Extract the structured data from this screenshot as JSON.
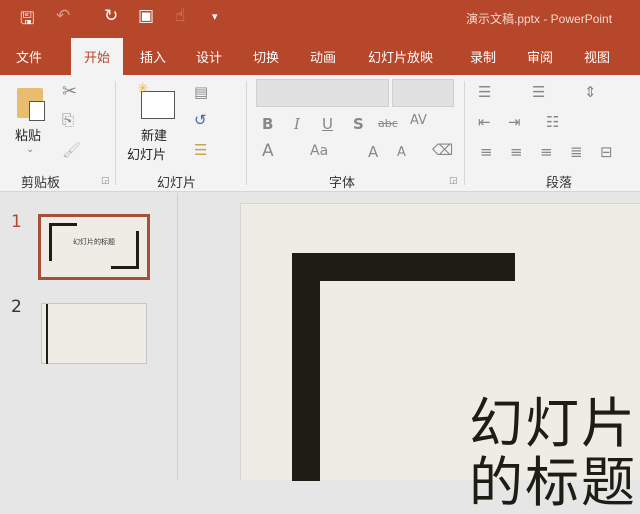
{
  "titlebar": {
    "title": "演示文稿.pptx - PowerPoint",
    "qat": [
      "save-icon",
      "undo-icon",
      "redo-icon",
      "present-icon",
      "touch-icon",
      "customize-icon"
    ]
  },
  "tabs": [
    "文件",
    "开始",
    "插入",
    "设计",
    "切换",
    "动画",
    "幻灯片放映",
    "录制",
    "审阅",
    "视图"
  ],
  "ribbon": {
    "clipboard": {
      "label": "剪贴板",
      "paste": "粘贴"
    },
    "slides": {
      "label": "幻灯片",
      "new_line1": "新建",
      "new_line2": "幻灯片"
    },
    "font": {
      "label": "字体",
      "bold": "B",
      "italic": "I",
      "underline": "U",
      "shadow": "S",
      "strike": "abc",
      "spacing": "AV",
      "color": "A",
      "case": "Aa",
      "grow": "A",
      "shrink": "A"
    },
    "paragraph": {
      "label": "段落"
    }
  },
  "slides_pane": {
    "items": [
      {
        "number": "1",
        "title": "幻灯片的标题"
      },
      {
        "number": "2"
      }
    ]
  },
  "slide": {
    "title": "幻灯片的标题"
  },
  "colors": {
    "accent": "#b7472a",
    "slide_bg": "#efece6"
  }
}
